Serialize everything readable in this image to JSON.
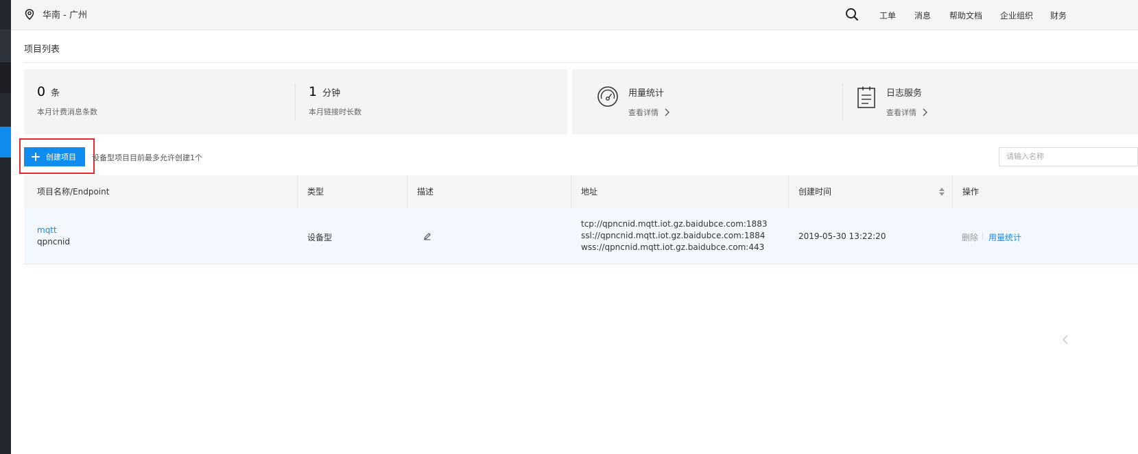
{
  "header": {
    "region": "华南 - 广州",
    "nav": [
      "工单",
      "消息",
      "帮助文档",
      "企业组织",
      "财务"
    ]
  },
  "page": {
    "title": "项目列表"
  },
  "stats": [
    {
      "value": "0",
      "unit": "条",
      "label": "本月计费消息条数"
    },
    {
      "value": "1",
      "unit": "分钟",
      "label": "本月链接时长数"
    }
  ],
  "services": [
    {
      "title": "用量统计",
      "detail": "查看详情"
    },
    {
      "title": "日志服务",
      "detail": "查看详情"
    }
  ],
  "toolbar": {
    "create_label": "创建项目",
    "tip": "设备型项目目前最多允许创建1个",
    "search_placeholder": "请输入名称"
  },
  "table": {
    "columns": [
      "项目名称/Endpoint",
      "类型",
      "描述",
      "地址",
      "创建时间",
      "操作"
    ],
    "rows": [
      {
        "name": "mqtt",
        "endpoint": "qpncnid",
        "type": "设备型",
        "addresses": [
          "tcp://qpncnid.mqtt.iot.gz.baidubce.com:1883",
          "ssl://qpncnid.mqtt.iot.gz.baidubce.com:1884",
          "wss://qpncnid.mqtt.iot.gz.baidubce.com:443"
        ],
        "created": "2019-05-30 13:22:20",
        "actions": [
          "删除",
          "用量统计"
        ]
      }
    ]
  },
  "colors": {
    "accent": "#108cee",
    "highlight_border": "#e8262b",
    "sidebar": "#23262e"
  }
}
